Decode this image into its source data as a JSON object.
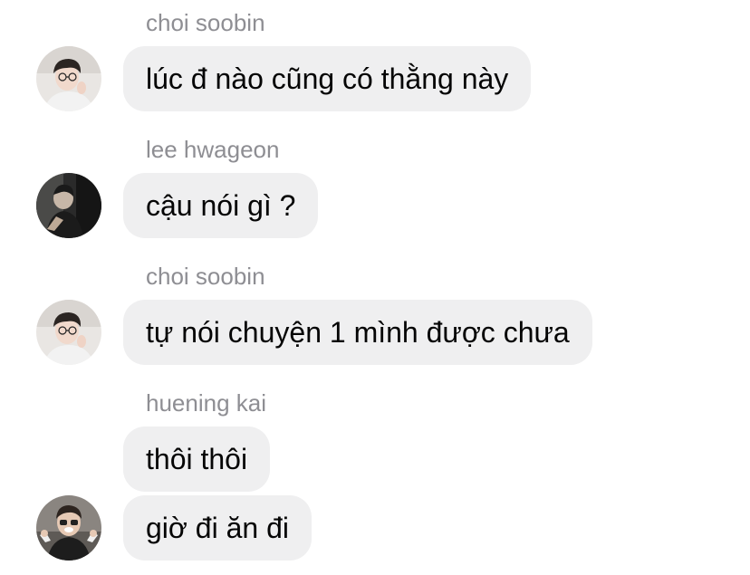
{
  "messages": [
    {
      "sender": "choi soobin",
      "text": "lúc đ nào cũng có thằng này",
      "avatar": "soobin-avatar"
    },
    {
      "sender": "lee hwageon",
      "text": "cậu nói gì ?",
      "avatar": "hwageon-avatar"
    },
    {
      "sender": "choi soobin",
      "text": "tự nói chuyện 1 mình được chưa",
      "avatar": "soobin-avatar"
    },
    {
      "sender": "huening kai",
      "text": "thôi thôi",
      "avatar": null
    },
    {
      "sender": null,
      "text": "giờ đi ăn đi",
      "avatar": "kai-avatar"
    }
  ],
  "colors": {
    "bubble_bg": "#efeff0",
    "sender_text": "#8e8e93",
    "message_text": "#050505",
    "background": "#ffffff"
  }
}
